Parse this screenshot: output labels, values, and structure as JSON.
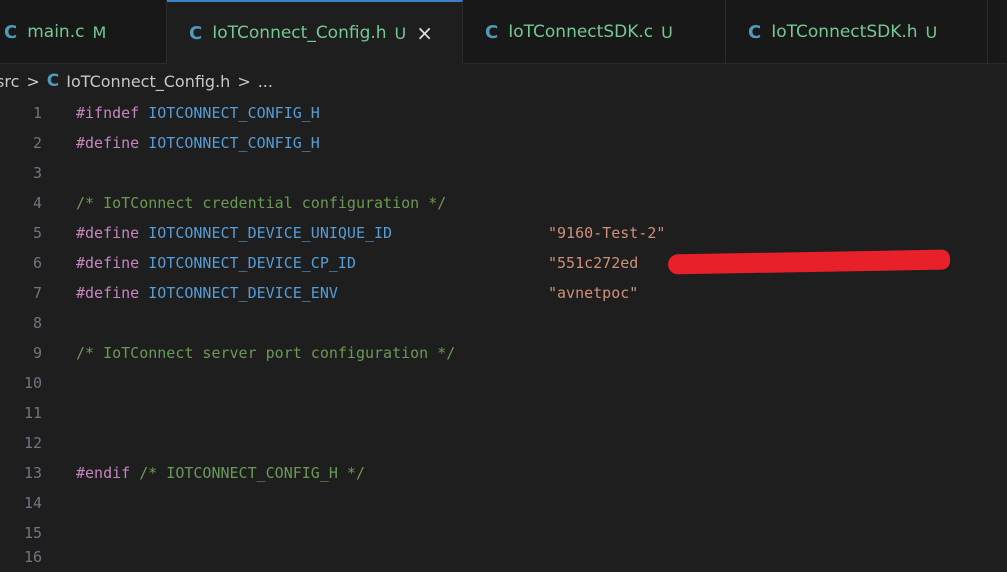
{
  "tabs": [
    {
      "icon": "C",
      "label": "main.c",
      "badge": "M",
      "active": false
    },
    {
      "icon": "C",
      "label": "IoTConnect_Config.h",
      "badge": "U",
      "active": true,
      "close": "×"
    },
    {
      "icon": "C",
      "label": "IoTConnectSDK.c",
      "badge": "U",
      "active": false
    },
    {
      "icon": "C",
      "label": "IoTConnectSDK.h",
      "badge": "U",
      "active": false
    }
  ],
  "breadcrumb": {
    "folder": "src",
    "separator": ">",
    "file_icon": "C",
    "file": "IoTConnect_Config.h",
    "more": "..."
  },
  "editor": {
    "lines": [
      {
        "n": "1",
        "kw": "#ifndef",
        "name": "IOTCONNECT_CONFIG_H"
      },
      {
        "n": "2",
        "kw": "#define",
        "name": "IOTCONNECT_CONFIG_H"
      },
      {
        "n": "3"
      },
      {
        "n": "4",
        "comment": "/* IoTConnect credential configuration */"
      },
      {
        "n": "5",
        "kw": "#define",
        "name": "IOTCONNECT_DEVICE_UNIQUE_ID",
        "value": "\"9160-Test-2\""
      },
      {
        "n": "6",
        "kw": "#define",
        "name": "IOTCONNECT_DEVICE_CP_ID",
        "value": "\"551c272ed"
      },
      {
        "n": "7",
        "kw": "#define",
        "name": "IOTCONNECT_DEVICE_ENV",
        "value": "\"avnetpoc\""
      },
      {
        "n": "8"
      },
      {
        "n": "9",
        "comment": "/* IoTConnect server port configuration */"
      },
      {
        "n": "10"
      },
      {
        "n": "11"
      },
      {
        "n": "12"
      },
      {
        "n": "13",
        "kw": "#endif",
        "comment": "/* IOTCONNECT_CONFIG_H */"
      },
      {
        "n": "14"
      },
      {
        "n": "15"
      },
      {
        "n": "16"
      }
    ]
  },
  "colors": {
    "keyword": "#c586c0",
    "macro": "#569cd6",
    "string": "#ce9178",
    "comment": "#6a9955",
    "modified": "#73c991",
    "redaction": "#e8202a"
  }
}
